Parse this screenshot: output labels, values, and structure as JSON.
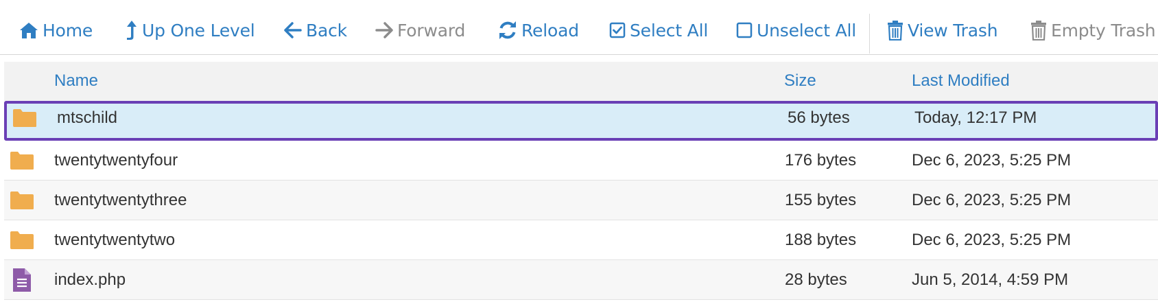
{
  "toolbar": {
    "home": {
      "label": "Home",
      "icon": "home-icon"
    },
    "up": {
      "label": "Up One Level",
      "icon": "level-up-icon"
    },
    "back": {
      "label": "Back",
      "icon": "arrow-left-icon"
    },
    "forward": {
      "label": "Forward",
      "icon": "arrow-right-icon"
    },
    "reload": {
      "label": "Reload",
      "icon": "refresh-icon"
    },
    "select_all": {
      "label": "Select All",
      "icon": "checkbox-checked-icon"
    },
    "unselect_all": {
      "label": "Unselect All",
      "icon": "checkbox-empty-icon"
    },
    "view_trash": {
      "label": "View Trash",
      "icon": "trash-icon"
    },
    "empty_trash": {
      "label": "Empty Trash",
      "icon": "trash-icon"
    }
  },
  "table": {
    "headers": {
      "name": "Name",
      "size": "Size",
      "modified": "Last Modified"
    },
    "rows": [
      {
        "type": "folder",
        "name": "mtschild",
        "size": "56 bytes",
        "modified": "Today, 12:17 PM",
        "selected": true
      },
      {
        "type": "folder",
        "name": "twentytwentyfour",
        "size": "176 bytes",
        "modified": "Dec 6, 2023, 5:25 PM"
      },
      {
        "type": "folder",
        "name": "twentytwentythree",
        "size": "155 bytes",
        "modified": "Dec 6, 2023, 5:25 PM"
      },
      {
        "type": "folder",
        "name": "twentytwentytwo",
        "size": "188 bytes",
        "modified": "Dec 6, 2023, 5:25 PM"
      },
      {
        "type": "file",
        "name": "index.php",
        "size": "28 bytes",
        "modified": "Jun 5, 2014, 4:59 PM"
      }
    ]
  },
  "colors": {
    "link": "#2f7ec2",
    "disabled": "#8c8c8c",
    "folder": "#f0ad4e",
    "file": "#8e5ba8",
    "selection_border": "#6a3fb5",
    "selection_bg": "#d9edf8"
  }
}
